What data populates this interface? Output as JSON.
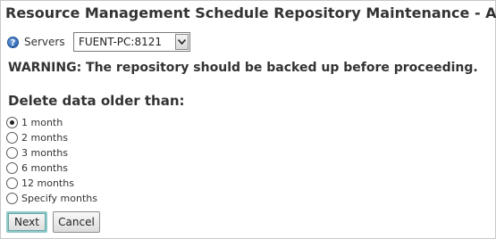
{
  "page": {
    "title": "Resource Management Schedule Repository Maintenance - Add"
  },
  "servers": {
    "label": "Servers",
    "help_icon": "question-circle-icon",
    "selected": "FUENT-PC:8121"
  },
  "warning": "WARNING: The repository should be backed up before proceeding.",
  "retention": {
    "heading": "Delete data older than:",
    "selected_index": 0,
    "options": [
      "1 month",
      "2 months",
      "3 months",
      "6 months",
      "12 months",
      "Specify months"
    ]
  },
  "buttons": {
    "next_label": "Next",
    "cancel_label": "Cancel"
  },
  "colors": {
    "text": "#333333",
    "border": "#c8c8c8",
    "help_icon": "#1f5aa8",
    "focus_ring": "#8fc9c9"
  }
}
